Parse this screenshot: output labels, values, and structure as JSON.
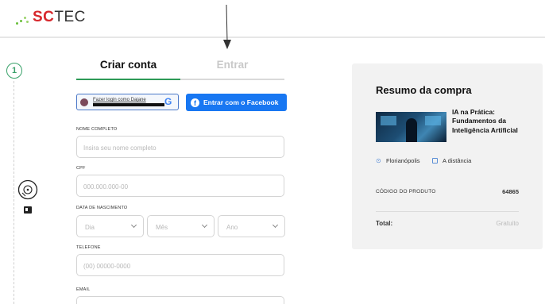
{
  "header": {
    "logo_text_red": "SC",
    "logo_text_grey": "TEC"
  },
  "steps": {
    "current": "1"
  },
  "tabs": {
    "create": "Criar conta",
    "login": "Entrar"
  },
  "social": {
    "google_label": "Fazer login como Dajane",
    "google_icon": "G",
    "facebook_label": "Entrar com o Facebook",
    "facebook_icon": "f"
  },
  "form": {
    "name": {
      "label": "NOME COMPLETO",
      "placeholder": "Insira seu nome completo"
    },
    "cpf": {
      "label": "CPF",
      "placeholder": "000.000.000-00"
    },
    "birth": {
      "label": "DATA DE NASCIMENTO",
      "day": "Dia",
      "month": "Mês",
      "year": "Ano"
    },
    "phone": {
      "label": "TELEFONE",
      "placeholder": "(00) 00000-0000"
    },
    "email": {
      "label": "EMAIL"
    }
  },
  "summary": {
    "title": "Resumo da compra",
    "product_name": "IA na Prática: Fundamentos da Inteligência Artificial",
    "location": "Florianópolis",
    "modality": "A distância",
    "code_label": "CÓDIGO DO PRODUTO",
    "code_value": "64865",
    "total_label": "Total:",
    "total_value": "Gratuito"
  },
  "colors": {
    "accent_green": "#2e9a57",
    "facebook_blue": "#1877f2",
    "brand_red": "#d7272c"
  }
}
